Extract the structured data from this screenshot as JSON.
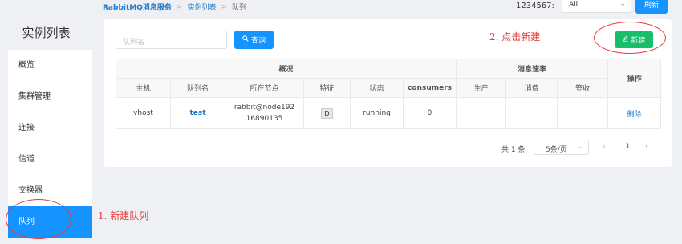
{
  "sidebar": {
    "title": "实例列表",
    "items": [
      {
        "label": "概览"
      },
      {
        "label": "集群管理"
      },
      {
        "label": "连接"
      },
      {
        "label": "信道"
      },
      {
        "label": "交换器"
      },
      {
        "label": "队列"
      }
    ],
    "active_index": 5
  },
  "breadcrumb": {
    "brand": "RabbitMQ消息服务",
    "sep": ">",
    "instances": "实例列表",
    "current": "队列"
  },
  "header": {
    "instance_label": "1234567:",
    "instance_value": "All",
    "refresh_label": "刷新"
  },
  "toolbar": {
    "search_placeholder": "队列名",
    "query_label": "查询",
    "create_label": "新建"
  },
  "table": {
    "group_overview": "概况",
    "group_rate": "消息速率",
    "operation": "操作",
    "columns": [
      "主机",
      "队列名",
      "所在节点",
      "特征",
      "状态",
      "consumers",
      "生产",
      "消费",
      "签收"
    ],
    "rows": [
      {
        "host": "vhost",
        "name": "test",
        "node_line1": "rabbit@node192",
        "node_line2": "16890135",
        "feature": "D",
        "status": "running",
        "consumers": "0",
        "produce": "",
        "consume": "",
        "ack": "",
        "action": "删除"
      }
    ]
  },
  "pagination": {
    "total": "共 1 条",
    "page_size": "5条/页",
    "current_page": "1"
  },
  "annotations": {
    "step1": "1. 新建队列",
    "step2": "2. 点击新建",
    "color": "#e63b3b"
  }
}
